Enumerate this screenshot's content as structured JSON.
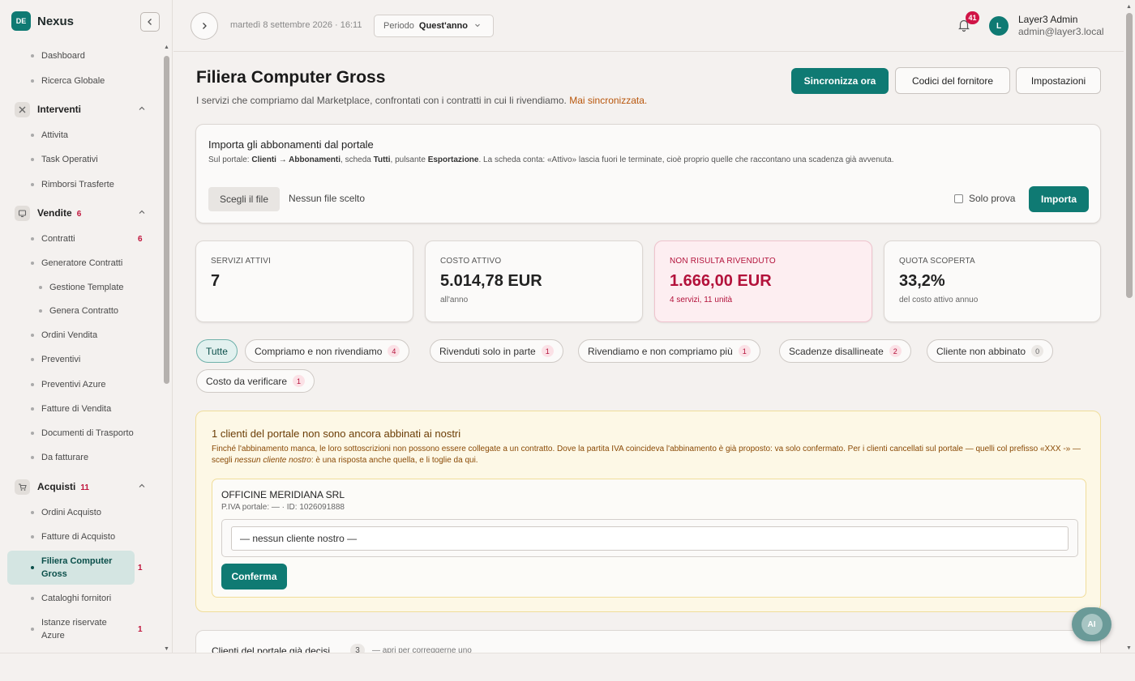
{
  "brand": {
    "badge": "DE",
    "name": "Nexus"
  },
  "sidebar": {
    "top_items": [
      {
        "label": "Dashboard"
      },
      {
        "label": "Ricerca Globale"
      }
    ],
    "sections": [
      {
        "label": "Interventi",
        "count": "",
        "icon": "tools-icon",
        "items": [
          {
            "label": "Attivita"
          },
          {
            "label": "Task Operativi"
          },
          {
            "label": "Rimborsi Trasferte"
          }
        ]
      },
      {
        "label": "Vendite",
        "count": "6",
        "icon": "monitor-icon",
        "items": [
          {
            "label": "Contratti",
            "count": "6"
          },
          {
            "label": "Generatore Contratti"
          },
          {
            "label": "Gestione Template",
            "sub": true
          },
          {
            "label": "Genera Contratto",
            "sub": true
          },
          {
            "label": "Ordini Vendita"
          },
          {
            "label": "Preventivi"
          },
          {
            "label": "Preventivi Azure"
          },
          {
            "label": "Fatture di Vendita"
          },
          {
            "label": "Documenti di Trasporto"
          },
          {
            "label": "Da fatturare"
          }
        ]
      },
      {
        "label": "Acquisti",
        "count": "11",
        "icon": "cart-icon",
        "items": [
          {
            "label": "Ordini Acquisto"
          },
          {
            "label": "Fatture di Acquisto"
          },
          {
            "label": "Filiera Computer Gross",
            "count": "1",
            "active": true
          },
          {
            "label": "Cataloghi fornitori"
          },
          {
            "label": "Istanze riservate Azure",
            "count": "1"
          }
        ]
      }
    ]
  },
  "topbar": {
    "datetime": "martedì 8 settembre 2026 · 16:11",
    "period_label": "Periodo",
    "period_value": "Quest'anno",
    "notifications": "41",
    "avatar": "L",
    "user_name": "Layer3 Admin",
    "user_email": "admin@layer3.local"
  },
  "page": {
    "title": "Filiera Computer Gross",
    "subtitle": "I servizi che compriamo dal Marketplace, confrontati con i contratti in cui li rivendiamo.",
    "subtitle_warn": "Mai sincronizzata.",
    "actions": {
      "sync": "Sincronizza ora",
      "codes": "Codici del fornitore",
      "settings": "Impostazioni"
    }
  },
  "import": {
    "title": "Importa gli abbonamenti dal portale",
    "desc_1": "Sul portale: ",
    "desc_b1": "Clienti → Abbonamenti",
    "desc_2": ", scheda ",
    "desc_b2": "Tutti",
    "desc_3": ", pulsante ",
    "desc_b3": "Esportazione",
    "desc_4": ". La scheda conta: «Attivo» lascia fuori le terminate, cioè proprio quelle che raccontano una scadenza già avvenuta.",
    "file_button": "Scegli il file",
    "file_none": "Nessun file scelto",
    "trial_label": "Solo prova",
    "import_button": "Importa"
  },
  "kpis": [
    {
      "label": "SERVIZI ATTIVI",
      "value": "7",
      "note": ""
    },
    {
      "label": "COSTO ATTIVO",
      "value": "5.014,78 EUR",
      "note": "all'anno"
    },
    {
      "label": "NON RISULTA RIVENDUTO",
      "value": "1.666,00 EUR",
      "note": "4 servizi, 11 unità",
      "alert": true
    },
    {
      "label": "QUOTA SCOPERTA",
      "value": "33,2%",
      "note": "del costo attivo annuo"
    }
  ],
  "filters": [
    {
      "label": "Tutte",
      "count": ""
    },
    {
      "label": "Compriamo e non rivendiamo",
      "count": "4"
    },
    {
      "label": "Rivenduti solo in parte",
      "count": "1"
    },
    {
      "label": "Rivendiamo e non compriamo più",
      "count": "1"
    },
    {
      "label": "Scadenze disallineate",
      "count": "2"
    },
    {
      "label": "Cliente non abbinato",
      "count": "0"
    },
    {
      "label": "Costo da verificare",
      "count": "1"
    }
  ],
  "matching": {
    "title": "1 clienti del portale non sono ancora abbinati ai nostri",
    "desc_1": "Finché l'abbinamento manca, le loro sottoscrizioni non possono essere collegate a un contratto. Dove la partita IVA coincideva l'abbinamento è già proposto: va solo confermato. Per i clienti cancellati sul portale — quelli col prefisso «XXX -» — scegli ",
    "desc_em": "nessun cliente nostro",
    "desc_2": ": è una risposta anche quella, e li toglie da qui.",
    "client_name": "OFFICINE MERIDIANA SRL",
    "client_vat": "P.IVA portale: — · ID: 1026091888",
    "select_value": "— nessun cliente nostro —",
    "confirm": "Conferma"
  },
  "decided": {
    "title": "Clienti del portale già decisi",
    "count": "3",
    "hint": "— apri per correggerne uno"
  },
  "ai": {
    "label": "AI"
  },
  "colors": {
    "accent": "#0f7a73",
    "alert": "#b3123b",
    "warning": "#b8560c"
  }
}
